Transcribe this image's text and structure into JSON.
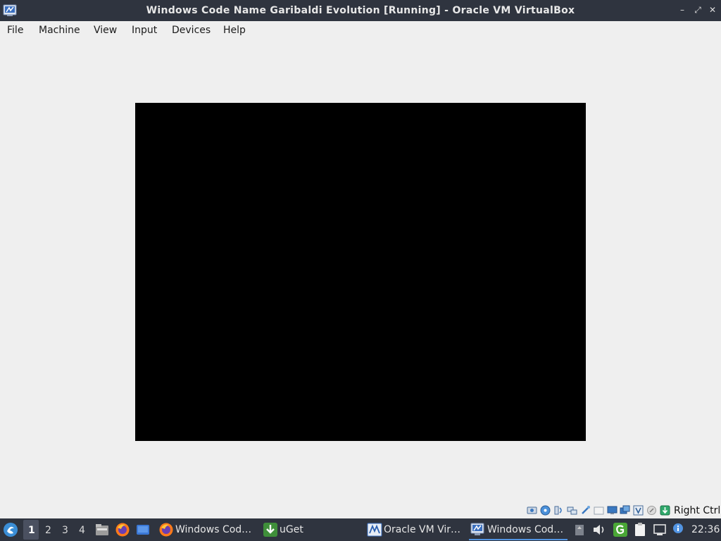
{
  "window": {
    "title": "Windows Code Name Garibaldi Evolution [Running] - Oracle VM VirtualBox",
    "controls": {
      "minimize": "–",
      "restore": "⤢",
      "close": "✕"
    }
  },
  "menu": {
    "file": "File",
    "machine": "Machine",
    "view": "View",
    "input": "Input",
    "devices": "Devices",
    "help": "Help"
  },
  "status_bar": {
    "host_key": "Right Ctrl",
    "icons": [
      "hard-disk-icon",
      "optical-drive-icon",
      "audio-icon",
      "network-icon",
      "usb-icon",
      "shared-folders-icon",
      "display-icon",
      "video-capture-icon",
      "virtualization-icon",
      "mouse-integration-icon",
      "keyboard-icon"
    ]
  },
  "taskbar": {
    "workspaces": [
      "1",
      "2",
      "3",
      "4"
    ],
    "active_workspace": "1",
    "tasks": [
      {
        "label": "Windows Cod…",
        "icon": "firefox-icon"
      },
      {
        "label": "uGet",
        "icon": "uget-icon"
      },
      {
        "label": "Oracle VM Vir…",
        "icon": "virtualbox-manager-icon"
      },
      {
        "label": "Windows Cod…",
        "icon": "vista-vm-icon"
      }
    ],
    "clock": "22:36"
  },
  "colors": {
    "titlebar_bg": "#2f343f",
    "body_bg": "#efefef",
    "vm_screen": "#000000",
    "taskbar_bg": "#2f343f",
    "accent": "#5294e2"
  }
}
